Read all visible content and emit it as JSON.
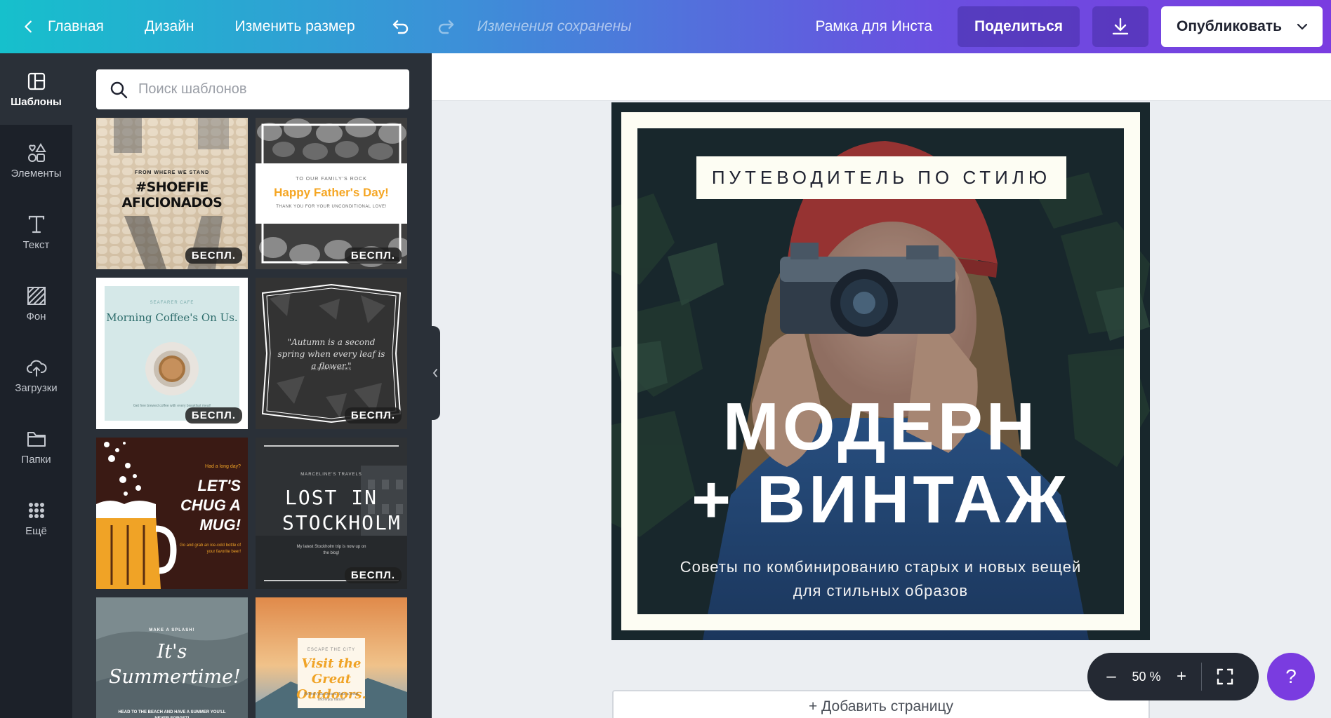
{
  "topbar": {
    "home": "Главная",
    "design": "Дизайн",
    "resize": "Изменить размер",
    "saved": "Изменения сохранены",
    "doc_name": "Рамка для Инста",
    "share": "Поделиться",
    "publish": "Опубликовать"
  },
  "rail": {
    "templates": "Шаблоны",
    "elements": "Элементы",
    "text": "Текст",
    "background": "Фон",
    "uploads": "Загрузки",
    "folders": "Папки",
    "more": "Ещё"
  },
  "search": {
    "placeholder": "Поиск шаблонов"
  },
  "templates": {
    "badge": "БЕСПЛ.",
    "t1": {
      "small": "FROM WHERE WE STAND",
      "title": "#SHOEFIE AFICIONADOS"
    },
    "t2": {
      "small": "TO OUR FAMILY'S ROCK",
      "title": "Happy Father's Day!",
      "sub": "THANK YOU FOR YOUR UNCONDITIONAL LOVE!"
    },
    "t3": {
      "small": "SEAFARER CAFE",
      "title": "Morning Coffee's On Us.",
      "sub": "Get free brewed coffee with every breakfast meal!"
    },
    "t4": {
      "quote": "\"Autumn is a second spring when every leaf is a flower.\"",
      "author": "ALBERT CAMUS"
    },
    "t5": {
      "small": "Had a long day?",
      "title": "LET'S CHUG A MUG!",
      "sub": "Go and grab an ice-cold bottle of your favorite beer!"
    },
    "t6": {
      "small": "MARCELINE'S TRAVELS",
      "title": "LOST IN STOCKHOLM",
      "sub": "My latest Stockholm trip is now up on the blog!"
    },
    "t7": {
      "small": "MAKE A SPLASH!",
      "title": "It's Summertime!",
      "sub": "HEAD TO THE BEACH AND HAVE A SUMMER YOU'LL NEVER FORGET!"
    },
    "t8": {
      "small": "ESCAPE THE CITY",
      "title": "Visit the Great Outdoors.",
      "sub": "Refresh your senses. Take a break and enjoy nature!"
    }
  },
  "design": {
    "subtitle": "ПУТЕВОДИТЕЛЬ ПО СТИЛЮ",
    "line1": "МОДЕРН",
    "line2": "+ ВИНТАЖ",
    "caption1": "Советы по комбинированию старых и новых вещей",
    "caption2": "для стильных образов"
  },
  "add_page": "+ Добавить страницу",
  "zoom": {
    "minus": "–",
    "value": "50 %",
    "plus": "+"
  },
  "help": "?",
  "colors": {
    "accent": "#7a3ce0",
    "teal": "#16c0cc",
    "frame": "#fdfdf3"
  }
}
